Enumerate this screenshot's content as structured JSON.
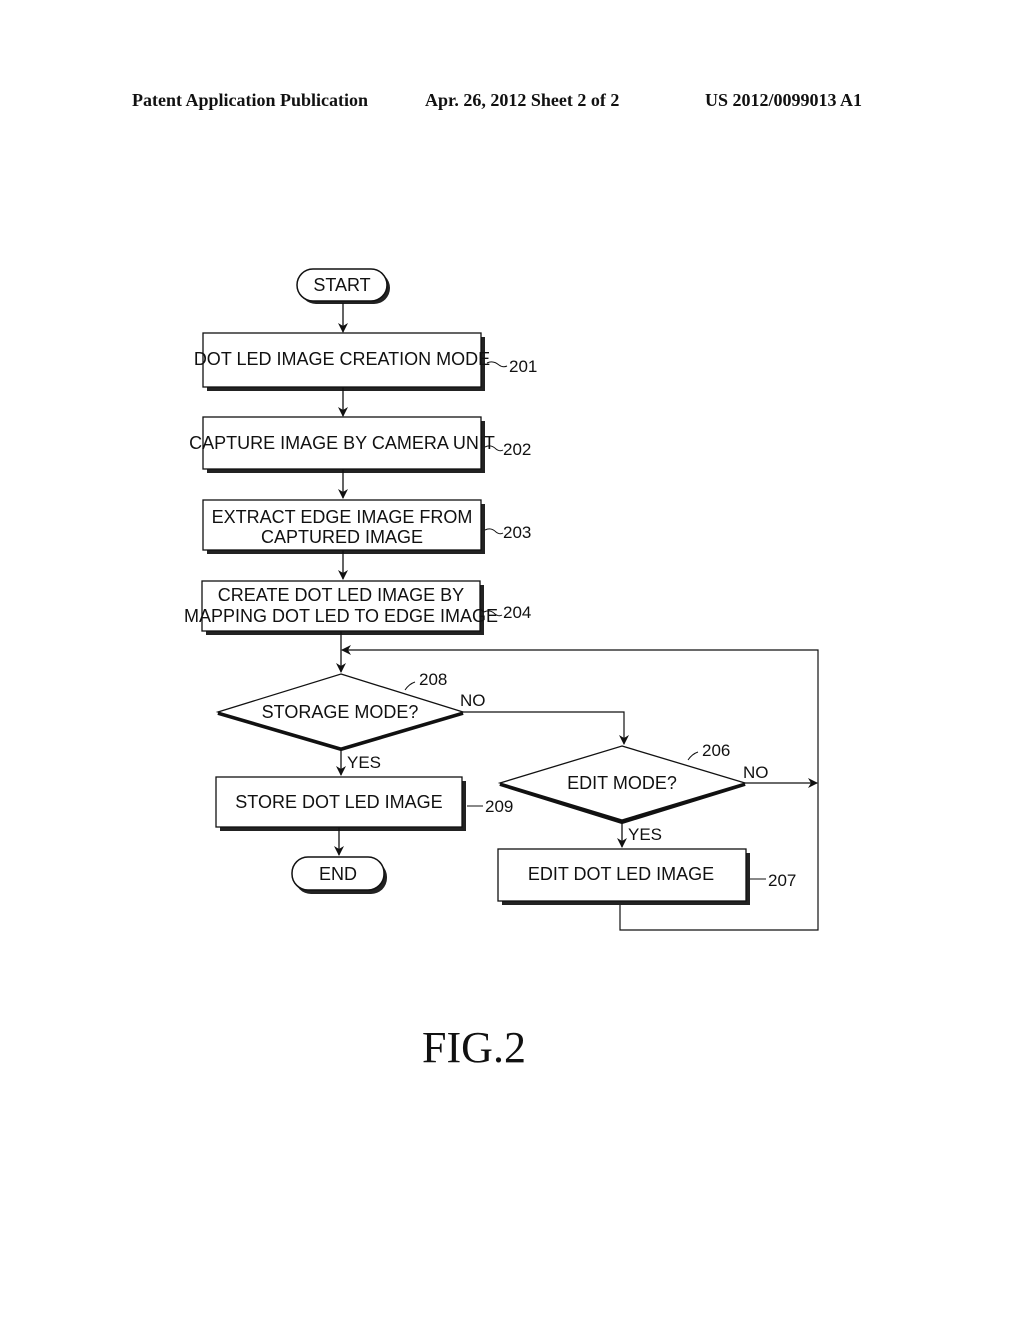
{
  "header": {
    "left": "Patent Application Publication",
    "middle": "Apr. 26, 2012  Sheet 2 of 2",
    "right": "US 2012/0099013 A1"
  },
  "flowchart": {
    "start": "START",
    "end": "END",
    "steps": {
      "s201": {
        "line1": "DOT LED IMAGE CREATION MODE",
        "ref": "201"
      },
      "s202": {
        "line1": "CAPTURE IMAGE BY CAMERA UNIT",
        "ref": "202"
      },
      "s203": {
        "line1": "EXTRACT EDGE IMAGE FROM",
        "line2": "CAPTURED IMAGE",
        "ref": "203"
      },
      "s204": {
        "line1": "CREATE DOT LED IMAGE BY",
        "line2": "MAPPING DOT LED TO EDGE IMAGE",
        "ref": "204"
      },
      "s209": {
        "line1": "STORE DOT LED IMAGE",
        "ref": "209"
      },
      "s207": {
        "line1": "EDIT DOT LED IMAGE",
        "ref": "207"
      }
    },
    "decisions": {
      "d208": {
        "label": "STORAGE MODE?",
        "ref": "208",
        "yes": "YES",
        "no": "NO"
      },
      "d206": {
        "label": "EDIT MODE?",
        "ref": "206",
        "yes": "YES",
        "no": "NO"
      }
    }
  },
  "figure_label": "FIG.2"
}
